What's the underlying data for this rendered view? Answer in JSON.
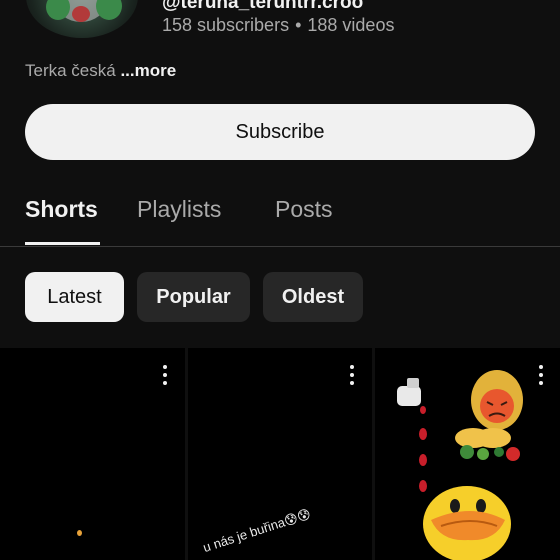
{
  "channel": {
    "handle": "@teruna_teruntrr.croo",
    "subscribers": "158 subscribers",
    "separator": "•",
    "videos": "188 videos",
    "description": "Terka česká",
    "more_label": "...more"
  },
  "subscribe_label": "Subscribe",
  "tabs": [
    {
      "label": "Shorts",
      "active": true
    },
    {
      "label": "Playlists",
      "active": false
    },
    {
      "label": "Posts",
      "active": false
    }
  ],
  "filters": [
    {
      "label": "Latest",
      "selected": true
    },
    {
      "label": "Popular",
      "selected": false
    },
    {
      "label": "Oldest",
      "selected": false
    }
  ],
  "shorts": [
    {
      "caption": ""
    },
    {
      "caption": "u nás je buřina😰😰"
    },
    {
      "caption": ""
    }
  ]
}
